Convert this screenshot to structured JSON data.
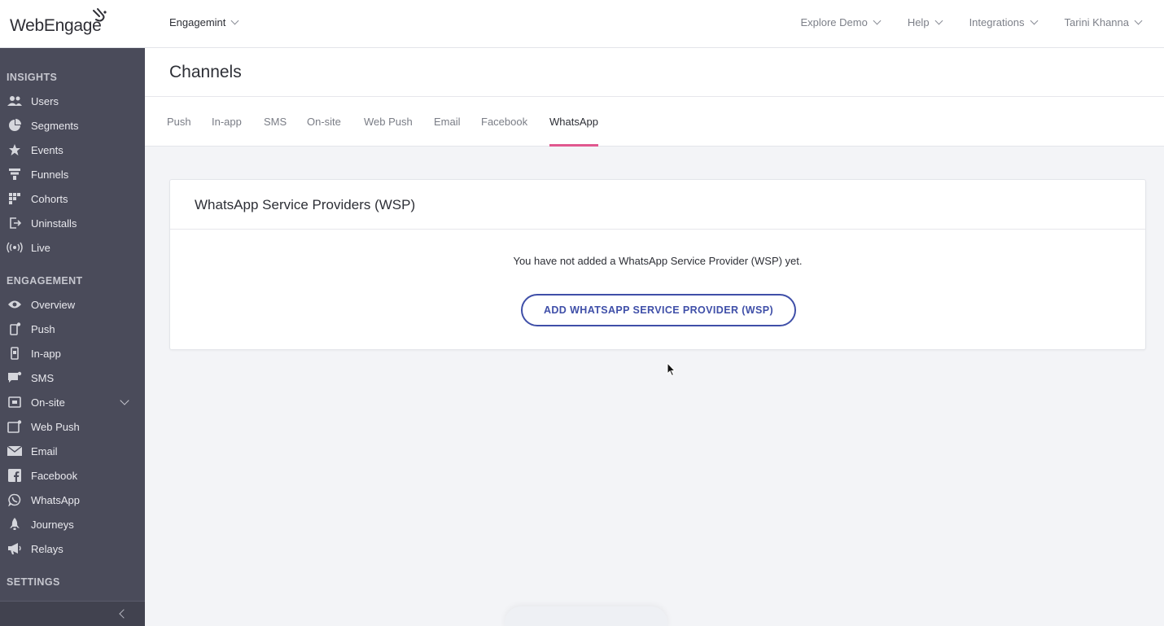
{
  "logo": {
    "text": "WebEngage"
  },
  "project": {
    "name": "Engagemint"
  },
  "topnav": [
    {
      "label": "Explore Demo"
    },
    {
      "label": "Help"
    },
    {
      "label": "Integrations"
    },
    {
      "label": "Tarini Khanna"
    }
  ],
  "sidebar": {
    "sections": {
      "insights": "INSIGHTS",
      "engagement": "ENGAGEMENT",
      "settings": "SETTINGS"
    },
    "insights": [
      {
        "label": "Users",
        "icon": "users-icon"
      },
      {
        "label": "Segments",
        "icon": "pie-chart-icon"
      },
      {
        "label": "Events",
        "icon": "star-icon"
      },
      {
        "label": "Funnels",
        "icon": "funnel-icon"
      },
      {
        "label": "Cohorts",
        "icon": "grid-icon"
      },
      {
        "label": "Uninstalls",
        "icon": "exit-icon"
      },
      {
        "label": "Live",
        "icon": "broadcast-icon"
      }
    ],
    "engagement": [
      {
        "label": "Overview",
        "icon": "eye-icon"
      },
      {
        "label": "Push",
        "icon": "mobile-push-icon"
      },
      {
        "label": "In-app",
        "icon": "mobile-icon"
      },
      {
        "label": "SMS",
        "icon": "chat-icon"
      },
      {
        "label": "On-site",
        "icon": "browser-icon"
      },
      {
        "label": "Web Push",
        "icon": "web-push-icon"
      },
      {
        "label": "Email",
        "icon": "envelope-icon"
      },
      {
        "label": "Facebook",
        "icon": "facebook-icon"
      },
      {
        "label": "WhatsApp",
        "icon": "whatsapp-icon"
      },
      {
        "label": "Journeys",
        "icon": "rocket-icon"
      },
      {
        "label": "Relays",
        "icon": "megaphone-icon"
      }
    ]
  },
  "page": {
    "title": "Channels"
  },
  "tabs": [
    {
      "label": "Push"
    },
    {
      "label": "In-app"
    },
    {
      "label": "SMS"
    },
    {
      "label": "On-site"
    },
    {
      "label": "Web Push"
    },
    {
      "label": "Email"
    },
    {
      "label": "Facebook"
    },
    {
      "label": "WhatsApp",
      "active": true
    }
  ],
  "card": {
    "title": "WhatsApp Service Providers (WSP)",
    "empty_message": "You have not added a WhatsApp Service Provider (WSP) yet.",
    "add_button": "ADD WHATSAPP SERVICE PROVIDER (WSP)"
  },
  "colors": {
    "sidebar_bg": "#4a4b5a",
    "accent_tab": "#e0588f",
    "primary_button": "#3f4fa8"
  }
}
